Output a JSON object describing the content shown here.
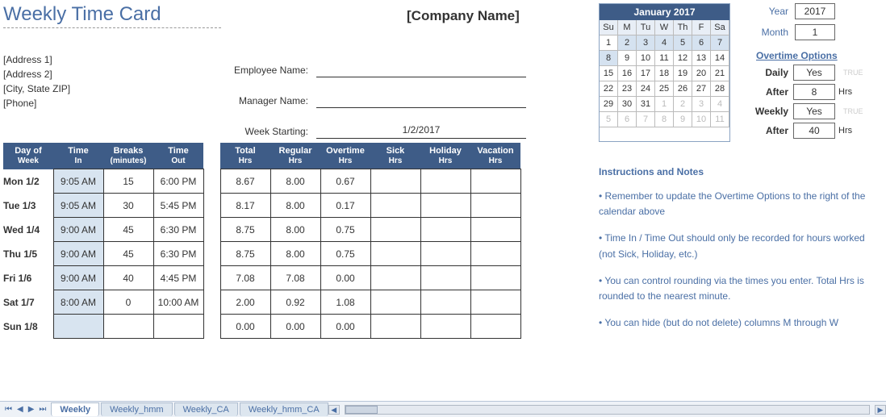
{
  "title": "Weekly Time Card",
  "company": "[Company Name]",
  "address": [
    "[Address 1]",
    "[Address 2]",
    "[City, State  ZIP]",
    "[Phone]"
  ],
  "fields": {
    "emp_lbl": "Employee Name:",
    "mgr_lbl": "Manager Name:",
    "week_lbl": "Week Starting:",
    "week_val": "1/2/2017"
  },
  "t1": {
    "hdr": [
      [
        "Day of",
        "Week"
      ],
      [
        "Time",
        "In"
      ],
      [
        "Breaks",
        "(minutes)"
      ],
      [
        "Time",
        "Out"
      ]
    ],
    "rows": [
      {
        "d": "Mon 1/2",
        "in": "9:05 AM",
        "br": "15",
        "out": "6:00 PM"
      },
      {
        "d": "Tue 1/3",
        "in": "9:05 AM",
        "br": "30",
        "out": "5:45 PM"
      },
      {
        "d": "Wed 1/4",
        "in": "9:00 AM",
        "br": "45",
        "out": "6:30 PM"
      },
      {
        "d": "Thu 1/5",
        "in": "9:00 AM",
        "br": "45",
        "out": "6:30 PM"
      },
      {
        "d": "Fri 1/6",
        "in": "9:00 AM",
        "br": "40",
        "out": "4:45 PM"
      },
      {
        "d": "Sat 1/7",
        "in": "8:00 AM",
        "br": "0",
        "out": "10:00 AM"
      },
      {
        "d": "Sun 1/8",
        "in": "",
        "br": "",
        "out": ""
      }
    ]
  },
  "t2": {
    "hdr": [
      [
        "Total",
        "Hrs"
      ],
      [
        "Regular",
        "Hrs"
      ],
      [
        "Overtime",
        "Hrs"
      ],
      [
        "Sick",
        "Hrs"
      ],
      [
        "Holiday",
        "Hrs"
      ],
      [
        "Vacation",
        "Hrs"
      ]
    ],
    "rows": [
      [
        "8.67",
        "8.00",
        "0.67",
        "",
        "",
        ""
      ],
      [
        "8.17",
        "8.00",
        "0.17",
        "",
        "",
        ""
      ],
      [
        "8.75",
        "8.00",
        "0.75",
        "",
        "",
        ""
      ],
      [
        "8.75",
        "8.00",
        "0.75",
        "",
        "",
        ""
      ],
      [
        "7.08",
        "7.08",
        "0.00",
        "",
        "",
        ""
      ],
      [
        "2.00",
        "0.92",
        "1.08",
        "",
        "",
        ""
      ],
      [
        "0.00",
        "0.00",
        "0.00",
        "",
        "",
        ""
      ]
    ]
  },
  "cal": {
    "title": "January 2017",
    "days": [
      "Su",
      "M",
      "Tu",
      "W",
      "Th",
      "F",
      "Sa"
    ],
    "cells": [
      {
        "v": "1"
      },
      {
        "v": "2",
        "s": 1
      },
      {
        "v": "3",
        "s": 1
      },
      {
        "v": "4",
        "s": 1
      },
      {
        "v": "5",
        "s": 1
      },
      {
        "v": "6",
        "s": 1
      },
      {
        "v": "7",
        "s": 1
      },
      {
        "v": "8",
        "s": 1
      },
      {
        "v": "9"
      },
      {
        "v": "10"
      },
      {
        "v": "11"
      },
      {
        "v": "12"
      },
      {
        "v": "13"
      },
      {
        "v": "14"
      },
      {
        "v": "15"
      },
      {
        "v": "16"
      },
      {
        "v": "17"
      },
      {
        "v": "18"
      },
      {
        "v": "19"
      },
      {
        "v": "20"
      },
      {
        "v": "21"
      },
      {
        "v": "22"
      },
      {
        "v": "23"
      },
      {
        "v": "24"
      },
      {
        "v": "25"
      },
      {
        "v": "26"
      },
      {
        "v": "27"
      },
      {
        "v": "28"
      },
      {
        "v": "29"
      },
      {
        "v": "30"
      },
      {
        "v": "31"
      },
      {
        "v": "1",
        "f": 1
      },
      {
        "v": "2",
        "f": 1
      },
      {
        "v": "3",
        "f": 1
      },
      {
        "v": "4",
        "f": 1
      },
      {
        "v": "5",
        "f": 1
      },
      {
        "v": "6",
        "f": 1
      },
      {
        "v": "7",
        "f": 1
      },
      {
        "v": "8",
        "f": 1
      },
      {
        "v": "9",
        "f": 1
      },
      {
        "v": "10",
        "f": 1
      },
      {
        "v": "11",
        "f": 1
      }
    ]
  },
  "ym": {
    "year_lbl": "Year",
    "year": "2017",
    "month_lbl": "Month",
    "month": "1"
  },
  "ot": {
    "title": "Overtime Options",
    "rows": [
      {
        "lbl": "Daily",
        "val": "Yes",
        "unit": "",
        "tf": "TRUE"
      },
      {
        "lbl": "After",
        "val": "8",
        "unit": "Hrs",
        "tf": ""
      },
      {
        "lbl": "Weekly",
        "val": "Yes",
        "unit": "",
        "tf": "TRUE"
      },
      {
        "lbl": "After",
        "val": "40",
        "unit": "Hrs",
        "tf": ""
      }
    ]
  },
  "instr": {
    "title": "Instructions and Notes",
    "lines": [
      "• Remember to update the Overtime Options to the right of the calendar above",
      "• Time In / Time Out should only be recorded for hours worked (not Sick, Holiday, etc.)",
      "• You can control rounding via the times you enter. Total Hrs is rounded to the nearest minute.",
      "• You can hide (but do not delete) columns M through W"
    ]
  },
  "tabs": [
    "Weekly",
    "Weekly_hmm",
    "Weekly_CA",
    "Weekly_hmm_CA"
  ],
  "active_tab": 0
}
